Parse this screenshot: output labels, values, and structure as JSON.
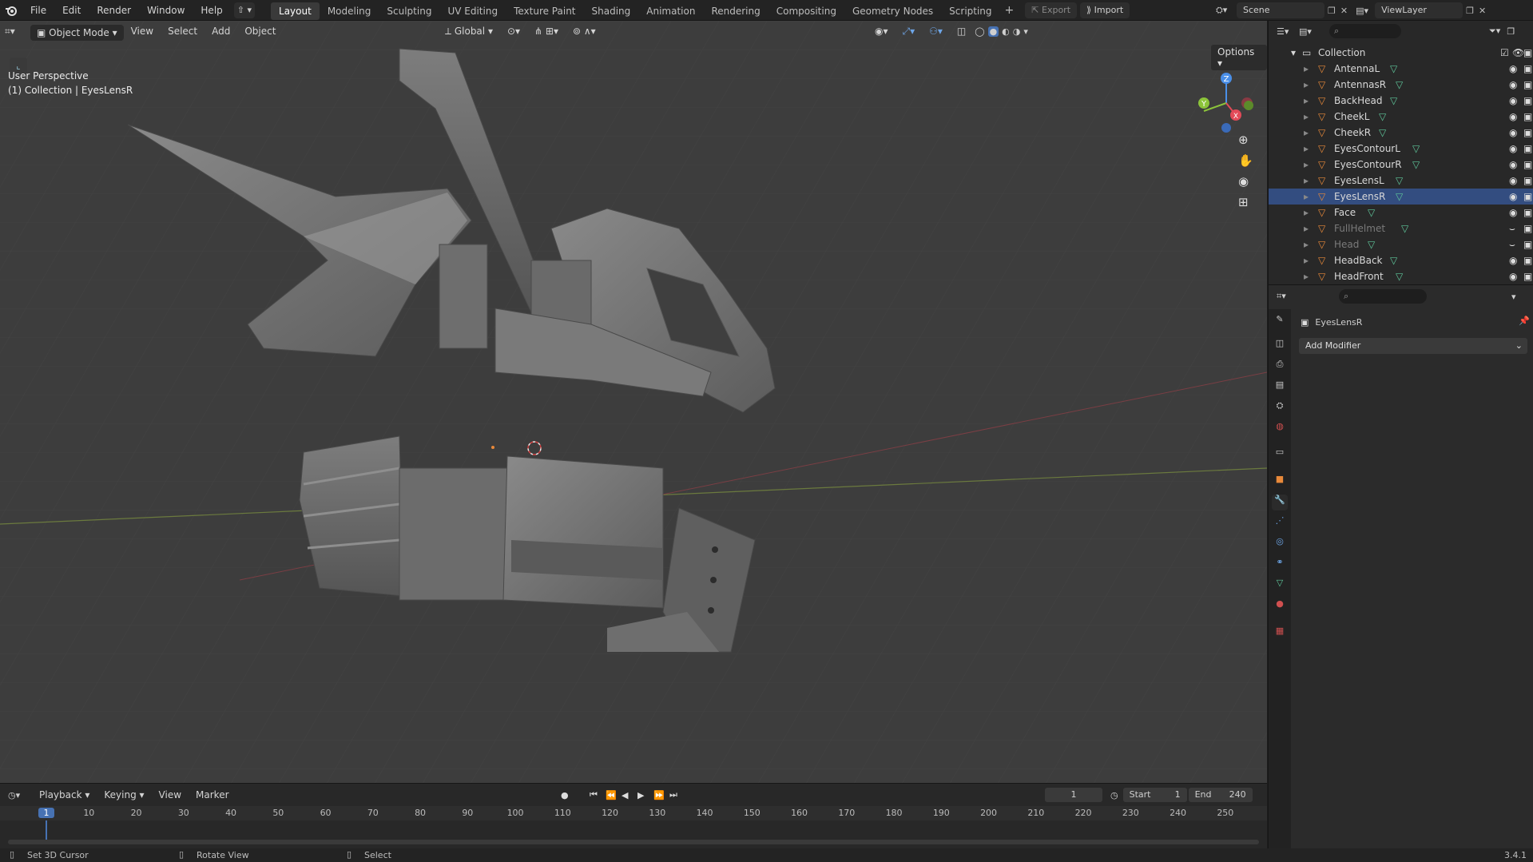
{
  "app": {
    "version": "3.4.1"
  },
  "topbar": {
    "menus": [
      "File",
      "Edit",
      "Render",
      "Window",
      "Help"
    ],
    "workspaces": [
      "Layout",
      "Modeling",
      "Sculpting",
      "UV Editing",
      "Texture Paint",
      "Shading",
      "Animation",
      "Rendering",
      "Compositing",
      "Geometry Nodes",
      "Scripting"
    ],
    "active_workspace": "Layout",
    "export_label": "Export",
    "import_label": "Import",
    "scene_name": "Scene",
    "view_layer": "ViewLayer"
  },
  "viewport": {
    "mode": "Object Mode",
    "menus": [
      "View",
      "Select",
      "Add",
      "Object"
    ],
    "transform_orientation": "Global",
    "perspective_label": "User Perspective",
    "context_label": "(1) Collection | EyesLensR",
    "options_label": "Options",
    "gizmo_axes": {
      "x": "X",
      "y": "Y",
      "z": "Z"
    }
  },
  "outliner": {
    "collection": "Collection",
    "items": [
      {
        "name": "AntennaL",
        "visible": true
      },
      {
        "name": "AntennasR",
        "visible": true
      },
      {
        "name": "BackHead",
        "visible": true
      },
      {
        "name": "CheekL",
        "visible": true
      },
      {
        "name": "CheekR",
        "visible": true
      },
      {
        "name": "EyesContourL",
        "visible": true
      },
      {
        "name": "EyesContourR",
        "visible": true
      },
      {
        "name": "EyesLensL",
        "visible": true
      },
      {
        "name": "EyesLensR",
        "visible": true
      },
      {
        "name": "Face",
        "visible": true
      },
      {
        "name": "FullHelmet",
        "visible": false
      },
      {
        "name": "Head",
        "visible": false
      },
      {
        "name": "HeadBack",
        "visible": true
      },
      {
        "name": "HeadFront",
        "visible": true
      }
    ]
  },
  "properties": {
    "object_name": "EyesLensR",
    "add_modifier_label": "Add Modifier"
  },
  "timeline": {
    "menus": [
      "Playback",
      "Keying",
      "View",
      "Marker"
    ],
    "current_frame": "1",
    "start_label": "Start",
    "start_value": "1",
    "end_label": "End",
    "end_value": "240",
    "ruler": [
      "1",
      "10",
      "20",
      "30",
      "40",
      "50",
      "60",
      "70",
      "80",
      "90",
      "100",
      "110",
      "120",
      "130",
      "140",
      "150",
      "160",
      "170",
      "180",
      "190",
      "200",
      "210",
      "220",
      "230",
      "240",
      "250"
    ]
  },
  "statusbar": {
    "hint1": "Set 3D Cursor",
    "hint2": "Rotate View",
    "hint3": "Select"
  },
  "colors": {
    "accent": "#4772b3",
    "selected_row": "#334d80",
    "object_orange": "#e8893a",
    "mesh_green": "#5fc79b"
  }
}
